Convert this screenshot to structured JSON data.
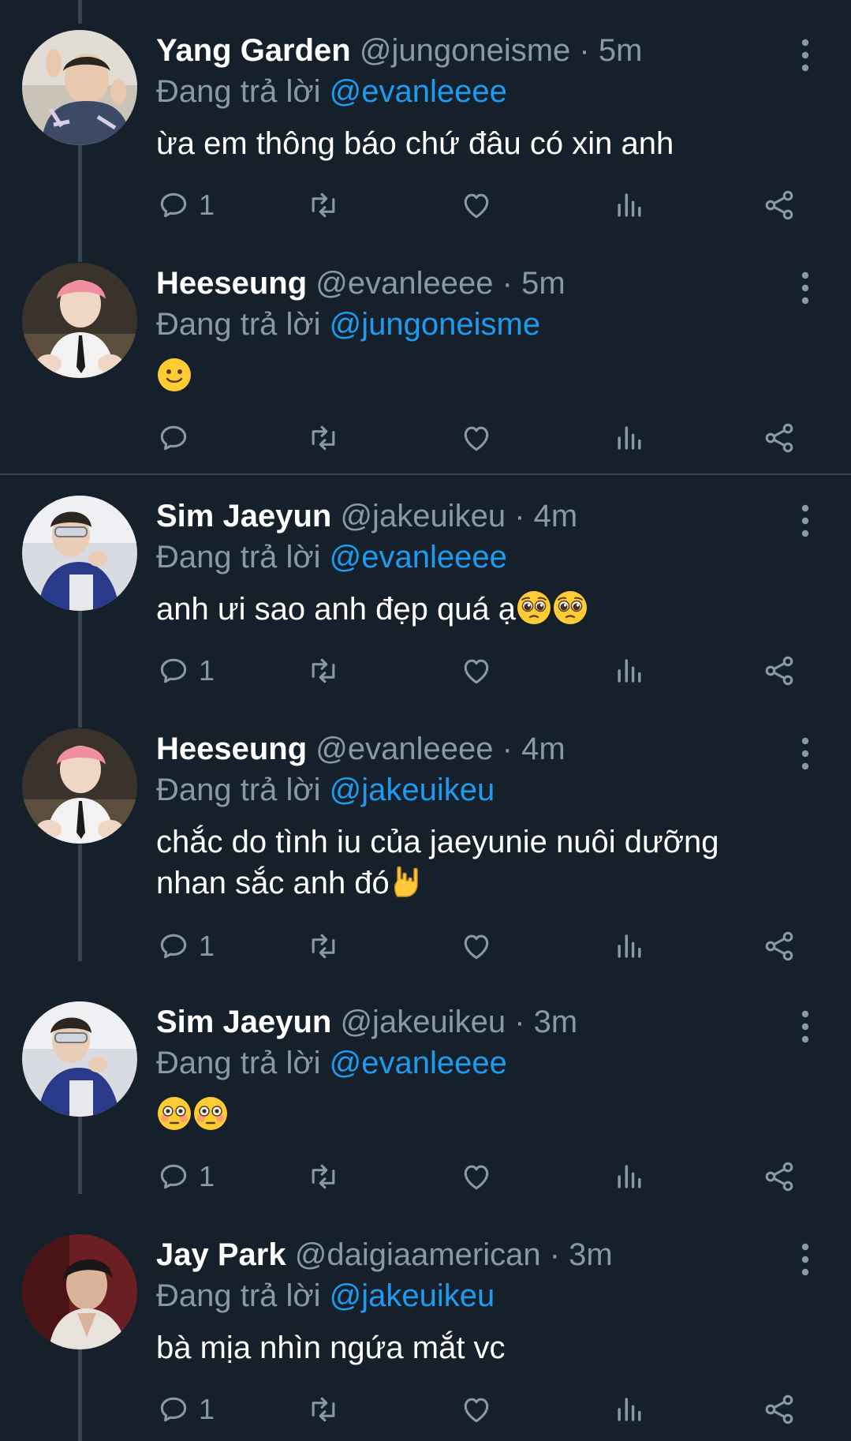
{
  "colors": {
    "background": "#15202b",
    "divider": "#38444d",
    "muted_text": "#8899a6",
    "mention": "#1d9bf0",
    "primary_text": "#ffffff"
  },
  "reply_prefix": "Đang trả lời",
  "tweets": [
    {
      "name": "Yang Garden",
      "handle": "@jungoneisme",
      "time": "· 5m",
      "reply_to": "@evanleeee",
      "text": "ừa em thông báo chứ đâu có xin anh",
      "emoji": [],
      "reply_count": "1",
      "avatar": "avatar-yang-garden"
    },
    {
      "name": "Heeseung",
      "handle": "@evanleeee",
      "time": "· 5m",
      "reply_to": "@jungoneisme",
      "text": "",
      "emoji": [
        "slightly-smiling-face"
      ],
      "reply_count": "",
      "avatar": "avatar-heeseung"
    },
    {
      "name": "Sim Jaeyun",
      "handle": "@jakeuikeu",
      "time": "· 4m",
      "reply_to": "@evanleeee",
      "text": "anh ưi sao anh đẹp quá ạ",
      "emoji": [
        "pleading-face",
        "pleading-face"
      ],
      "reply_count": "1",
      "avatar": "avatar-sim-jaeyun"
    },
    {
      "name": "Heeseung",
      "handle": "@evanleeee",
      "time": "· 4m",
      "reply_to": "@jakeuikeu",
      "text_line1": "chắc do tình iu của jaeyunie nuôi dưỡng",
      "text_line2": "nhan sắc anh đó",
      "emoji": [
        "sign-of-the-horns"
      ],
      "reply_count": "1",
      "avatar": "avatar-heeseung"
    },
    {
      "name": "Sim Jaeyun",
      "handle": "@jakeuikeu",
      "time": "· 3m",
      "reply_to": "@evanleeee",
      "text": "",
      "emoji": [
        "flushed-face",
        "flushed-face"
      ],
      "reply_count": "1",
      "avatar": "avatar-sim-jaeyun"
    },
    {
      "name": "Jay Park",
      "handle": "@daigiaamerican",
      "time": "· 3m",
      "reply_to": "@jakeuikeu",
      "text": "bà mịa nhìn ngứa mắt vc",
      "emoji": [],
      "reply_count": "1",
      "avatar": "avatar-jay-park"
    }
  ],
  "icons": {
    "reply": "comment-icon",
    "retweet": "retweet-icon",
    "like": "heart-icon",
    "analytics": "analytics-icon",
    "share": "share-icon",
    "more": "more-vertical-icon"
  }
}
